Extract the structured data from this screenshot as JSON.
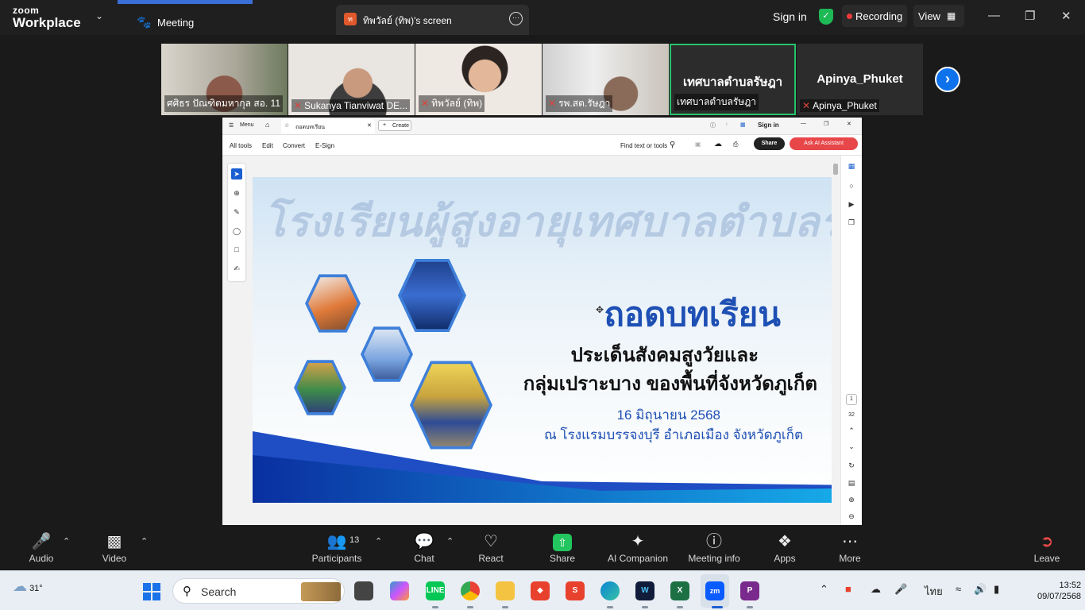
{
  "topbar": {
    "brand_line1": "zoom",
    "brand_line2": "Workplace",
    "tab_meeting": "Meeting",
    "tab_share": "ทิพวัลย์ (ทิพ)'s screen",
    "tab_share_avatar": "ท",
    "sign_in": "Sign in",
    "recording": "Recording",
    "view": "View"
  },
  "participants": [
    {
      "name": "ศศิธร ปัณฑิตมหากุล สอ. 11",
      "muted": false
    },
    {
      "name": "Sukanya Tianviwat DE...",
      "muted": true
    },
    {
      "name": "ทิพวัลย์ (ทิพ)",
      "muted": true
    },
    {
      "name": "รพ.สต.รัษฎา",
      "muted": true
    },
    {
      "name": "เทศบาลตำบลรัษฎา",
      "display": "เทศบาลตำบลรัษฎา",
      "muted": false
    },
    {
      "name": "Apinya_Phuket",
      "display": "Apinya_Phuket",
      "muted": true
    }
  ],
  "acrobat": {
    "menu": "Menu",
    "tab_title": "ถอดบทเรียน",
    "create": "Create",
    "sign_in": "Sign in",
    "all_tools": "All tools",
    "edit": "Edit",
    "convert": "Convert",
    "esign": "E-Sign",
    "find": "Find text or tools",
    "share": "Share",
    "ask_ai": "Ask AI Assistant",
    "page_current": "1",
    "page_total": "32"
  },
  "slide": {
    "watermark": "โรงเรียนผู้สูงอายุเทศบาลตำบลรัษฎา",
    "title": "ถอดบทเรียน",
    "subtitle_1": "ประเด็นสังคมสูงวัยและ",
    "subtitle_2": "กลุ่มเปราะบาง ของพื้นที่จังหวัดภูเก็ต",
    "date": "16 มิถุนายน 2568",
    "venue": "ณ โรงแรมบรรจงบุรี อำเภอเมือง จังหวัดภูเก็ต"
  },
  "controls": {
    "audio": "Audio",
    "video": "Video",
    "participants": "Participants",
    "participants_count": "13",
    "chat": "Chat",
    "react": "React",
    "share": "Share",
    "ai_companion": "AI Companion",
    "meeting_info": "Meeting info",
    "apps": "Apps",
    "more": "More",
    "leave": "Leave"
  },
  "taskbar": {
    "temperature": "31°",
    "search": "Search",
    "language": "ไทย",
    "time": "13:52",
    "date": "09/07/2568"
  },
  "colors": {
    "zoom_blue": "#0e72ed",
    "share_green": "#22c55e",
    "recording_red": "#f03a3a",
    "acrobat_red": "#e8474a"
  }
}
